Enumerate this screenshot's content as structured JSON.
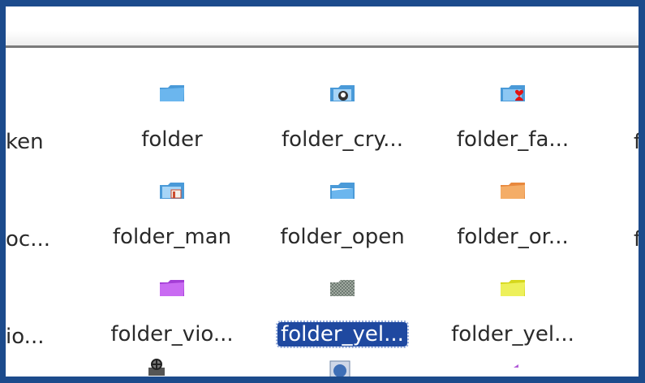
{
  "items": [
    {
      "label": "ken"
    },
    {
      "label": "folder"
    },
    {
      "label": "folder_cry..."
    },
    {
      "label": "folder_fa..."
    },
    {
      "label": "f"
    },
    {
      "label": "oc..."
    },
    {
      "label": "folder_man"
    },
    {
      "label": "folder_open"
    },
    {
      "label": "folder_or..."
    },
    {
      "label": "f"
    },
    {
      "label": "io..."
    },
    {
      "label": "folder_vio..."
    },
    {
      "label": "folder_yel..."
    },
    {
      "label": "folder_yel..."
    }
  ],
  "icons": {
    "folder": "folder-icon",
    "folder_crypto": "folder-crypto-icon",
    "folder_favorite": "folder-favorite-icon",
    "folder_man": "folder-man-icon",
    "folder_open": "folder-open-icon",
    "folder_orange": "folder-orange-icon",
    "folder_violet": "folder-violet-icon",
    "folder_yellow_selected": "folder-yellow-selected-icon",
    "folder_yellow": "folder-yellow-icon",
    "bottom_1": "network-icon",
    "bottom_2": "globe-icon",
    "bottom_3": "arrow-icon"
  },
  "colors": {
    "frame": "#1c4b8c",
    "selection": "#1f49a0",
    "text": "#2a2a2a"
  }
}
